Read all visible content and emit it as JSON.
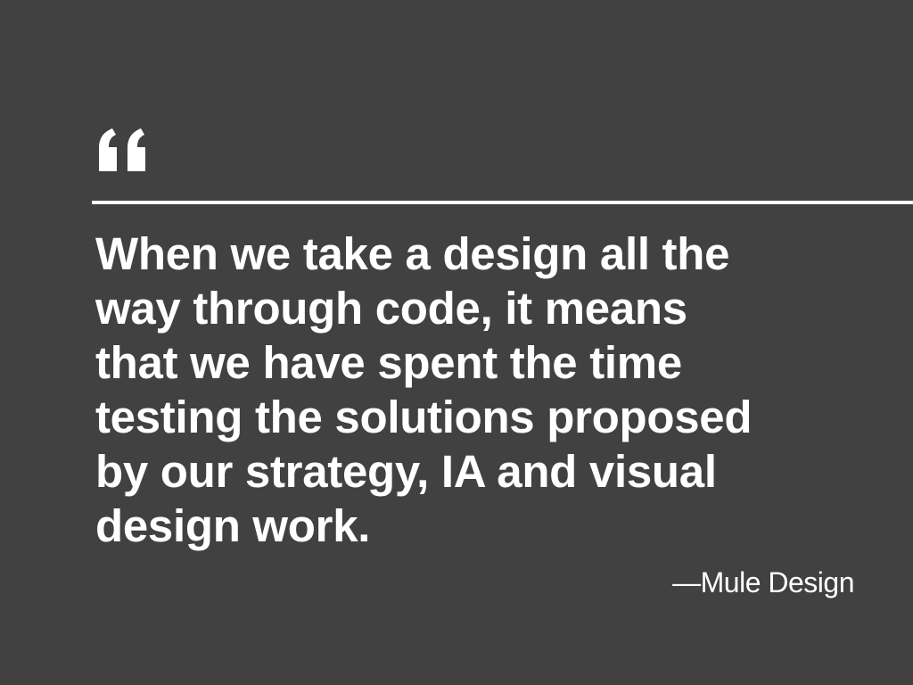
{
  "colors": {
    "background": "#414141",
    "foreground": "#ffffff"
  },
  "icon": "left-double-quote-icon",
  "quote": {
    "lines": [
      "When we take a design all the",
      "way through code, it means",
      "that we have spent the time",
      "testing the solutions proposed",
      "by our strategy, IA and visual",
      "design work."
    ]
  },
  "attribution": "—Mule Design"
}
